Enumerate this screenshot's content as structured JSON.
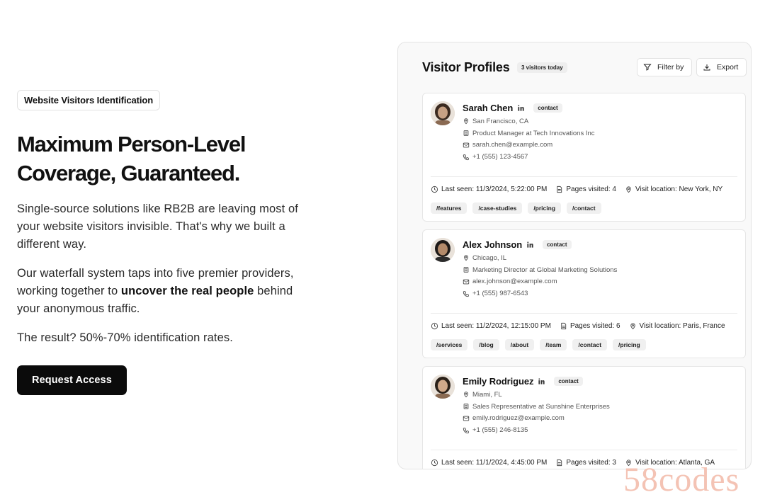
{
  "hero": {
    "badge": "Website Visitors Identification",
    "headline_line1": "Maximum Person-Level",
    "headline_line2": "Coverage, Guaranteed.",
    "para1": "Single-source solutions like RB2B are leaving most of your website visitors invisible. That's why we built a different way.",
    "para2_pre": "Our waterfall system taps into five premier providers, working together to ",
    "para2_bold": "uncover the real people",
    "para2_post": " behind your anonymous traffic.",
    "para3": "The result? 50%-70% identification rates.",
    "cta": "Request Access"
  },
  "panel": {
    "title": "Visitor Profiles",
    "count": "3 visitors today",
    "filter_label": "Filter by",
    "export_label": "Export"
  },
  "profiles": [
    {
      "name": "Sarah Chen",
      "tag": "contact",
      "location": "San Francisco, CA",
      "role": "Product Manager at Tech Innovations Inc",
      "email": "sarah.chen@example.com",
      "phone": "+1 (555) 123-4567",
      "last_seen": "Last seen: 11/3/2024, 5:22:00 PM",
      "pages_visited": "Pages visited: 4",
      "visit_location": "Visit location: New York, NY",
      "pages": [
        "/features",
        "/case-studies",
        "/pricing",
        "/contact"
      ]
    },
    {
      "name": "Alex Johnson",
      "tag": "contact",
      "location": "Chicago, IL",
      "role": "Marketing Director at Global Marketing Solutions",
      "email": "alex.johnson@example.com",
      "phone": "+1 (555) 987-6543",
      "last_seen": "Last seen: 11/2/2024, 12:15:00 PM",
      "pages_visited": "Pages visited: 6",
      "visit_location": "Visit location: Paris, France",
      "pages": [
        "/services",
        "/blog",
        "/about",
        "/team",
        "/contact",
        "/pricing"
      ]
    },
    {
      "name": "Emily Rodriguez",
      "tag": "contact",
      "location": "Miami, FL",
      "role": "Sales Representative at Sunshine Enterprises",
      "email": "emily.rodriguez@example.com",
      "phone": "+1 (555) 246-8135",
      "last_seen": "Last seen: 11/1/2024, 4:45:00 PM",
      "pages_visited": "Pages visited: 3",
      "visit_location": "Visit location: Atlanta, GA",
      "pages": []
    }
  ],
  "watermark": "58codes",
  "icons": [
    "linkedin-icon",
    "map-pin-icon",
    "building-icon",
    "mail-icon",
    "phone-icon",
    "clock-icon",
    "document-icon",
    "filter-icon",
    "download-icon"
  ]
}
